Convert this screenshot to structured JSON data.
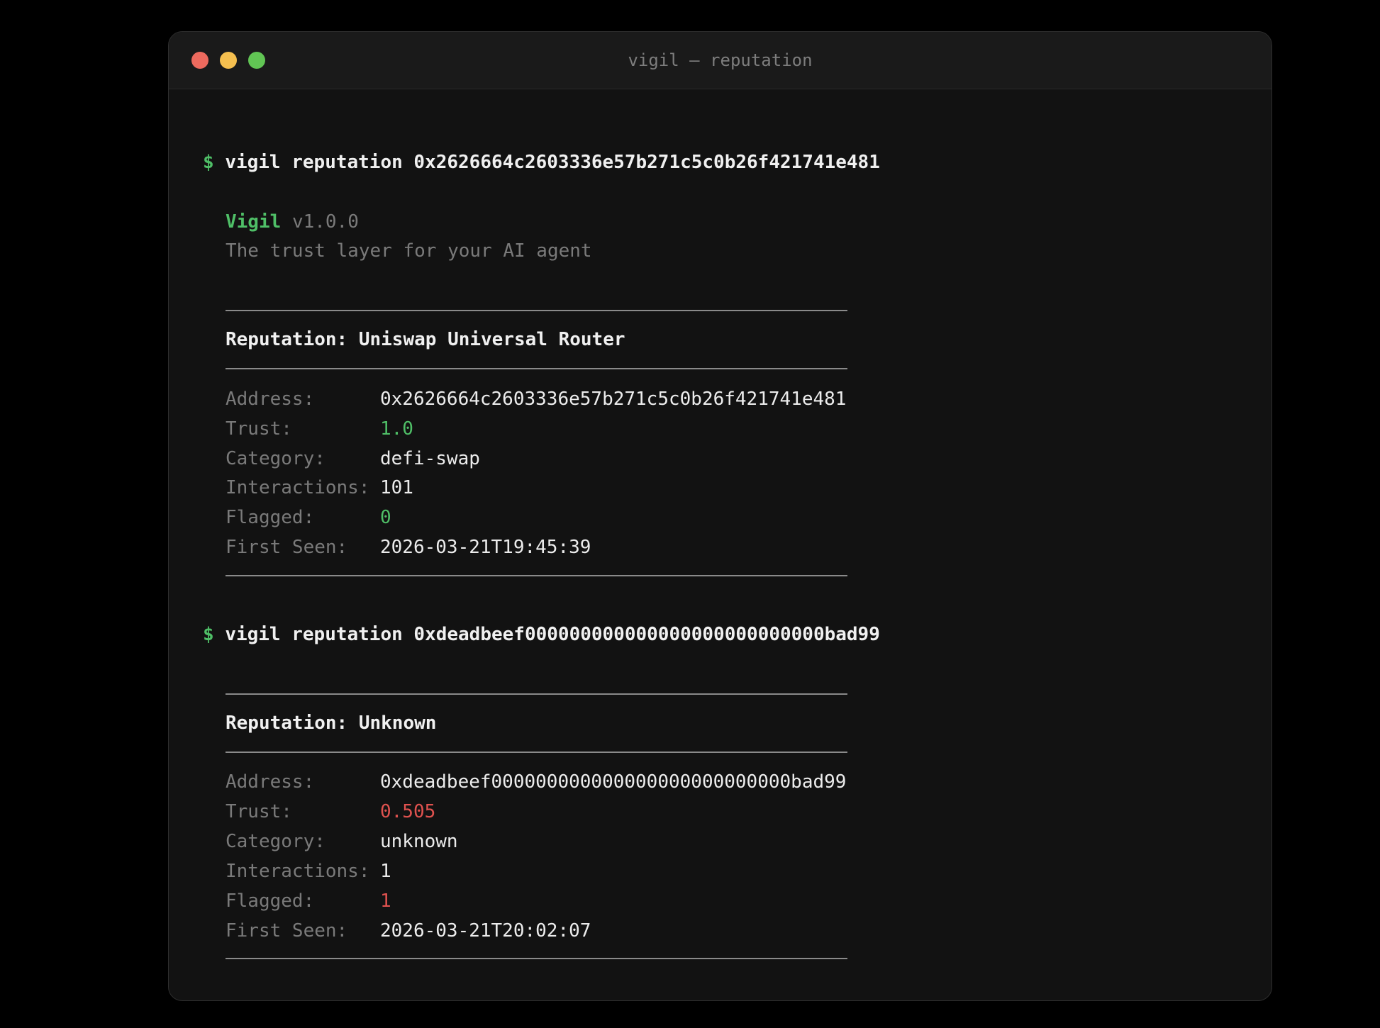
{
  "window": {
    "title": "vigil — reputation",
    "traffic_lights": {
      "close_color": "#ed6a5e",
      "minimize_color": "#f5bf4f",
      "maximize_color": "#61c554"
    }
  },
  "colors": {
    "accent_green": "#4fbf67",
    "danger_red": "#e0524f"
  },
  "terminal": {
    "prompt_symbol": "$",
    "command1": "vigil reputation 0x2626664c2603336e57b271c5c0b26f421741e481",
    "banner": {
      "name": "Vigil",
      "version": "v1.0.0",
      "tagline": "The trust layer for your AI agent"
    },
    "report1": {
      "heading": "Reputation: Uniswap Universal Router",
      "fields": [
        {
          "label": "Address:",
          "value": "0x2626664c2603336e57b271c5c0b26f421741e481"
        },
        {
          "label": "Trust:",
          "value": "1.0"
        },
        {
          "label": "Category:",
          "value": "defi-swap"
        },
        {
          "label": "Interactions:",
          "value": "101"
        },
        {
          "label": "Flagged:",
          "value": "0"
        },
        {
          "label": "First Seen:",
          "value": "2026-03-21T19:45:39"
        }
      ]
    },
    "command2": "vigil reputation 0xdeadbeef000000000000000000000000000bad99",
    "report2": {
      "heading": "Reputation: Unknown",
      "fields": [
        {
          "label": "Address:",
          "value": "0xdeadbeef000000000000000000000000000bad99"
        },
        {
          "label": "Trust:",
          "value": "0.505"
        },
        {
          "label": "Category:",
          "value": "unknown"
        },
        {
          "label": "Interactions:",
          "value": "1"
        },
        {
          "label": "Flagged:",
          "value": "1"
        },
        {
          "label": "First Seen:",
          "value": "2026-03-21T20:02:07"
        }
      ]
    }
  }
}
